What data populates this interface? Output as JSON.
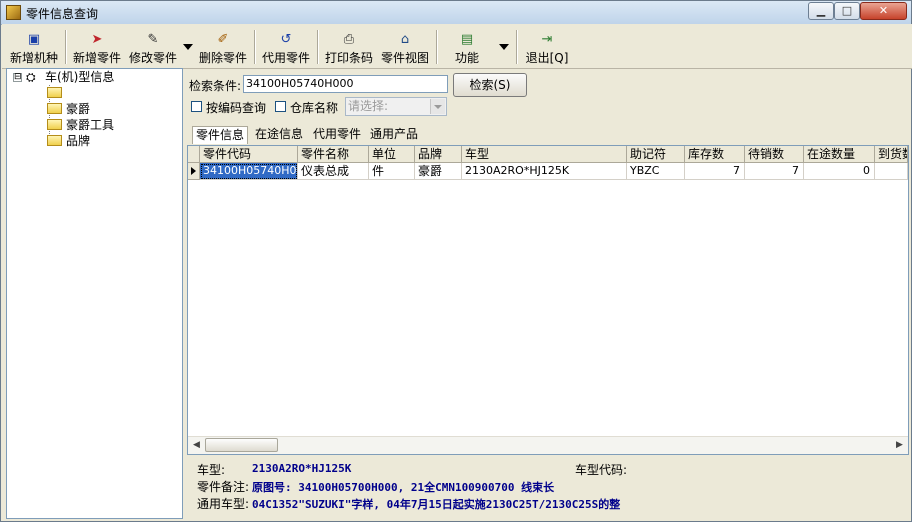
{
  "window": {
    "title": "零件信息查询",
    "controls": {
      "minimize": "▁",
      "maximize": "□",
      "close": "✕"
    }
  },
  "toolbar": {
    "buttons": [
      {
        "label": "新增机种",
        "icon": "add-model-icon"
      },
      {
        "label": "新增零件",
        "icon": "add-part-icon"
      },
      {
        "label": "修改零件",
        "icon": "edit-part-icon"
      },
      {
        "label": "删除零件",
        "icon": "delete-part-icon"
      },
      {
        "label": "代用零件",
        "icon": "substitute-part-icon"
      },
      {
        "label": "打印条码",
        "icon": "print-barcode-icon"
      },
      {
        "label": "零件视图",
        "icon": "part-view-icon"
      },
      {
        "label": "功能",
        "icon": "function-icon"
      },
      {
        "label": "退出[Q]",
        "icon": "exit-icon"
      }
    ]
  },
  "tree": {
    "root": "车(机)型信息",
    "expander": "⊟",
    "children": [
      "",
      "豪爵",
      "豪爵工具",
      "品牌"
    ]
  },
  "search": {
    "label": "检索条件:",
    "value": "34100H05740H000",
    "button": "检索(S)",
    "by_code_label": "按编码查询",
    "warehouse_label": "仓库名称",
    "warehouse_placeholder": "请选择:"
  },
  "tabs": [
    "零件信息",
    "在途信息",
    "代用零件",
    "通用产品"
  ],
  "grid": {
    "headers": [
      "零件代码",
      "零件名称",
      "单位",
      "品牌",
      "车型",
      "助记符",
      "库存数",
      "待销数",
      "在途数量",
      "到货数"
    ],
    "rows": [
      [
        "34100H05740H000",
        "仪表总成",
        "件",
        "豪爵",
        "2130A2RO*HJ125K",
        "YBZC",
        "7",
        "7",
        "0",
        ""
      ]
    ]
  },
  "details": {
    "model_label": "车型:",
    "model_value": "2130A2RO*HJ125K",
    "model_code_label": "车型代码:",
    "model_code_value": "",
    "remark_label": "零件备注:",
    "remark_value": "原图号: 34100H05700H000, 21全CMN100900700   线束长",
    "common_label": "通用车型:",
    "common_value": "04C1352\"SUZUKI\"字样, 04年7月15日起实施2130C25T/2130C25S的整"
  }
}
